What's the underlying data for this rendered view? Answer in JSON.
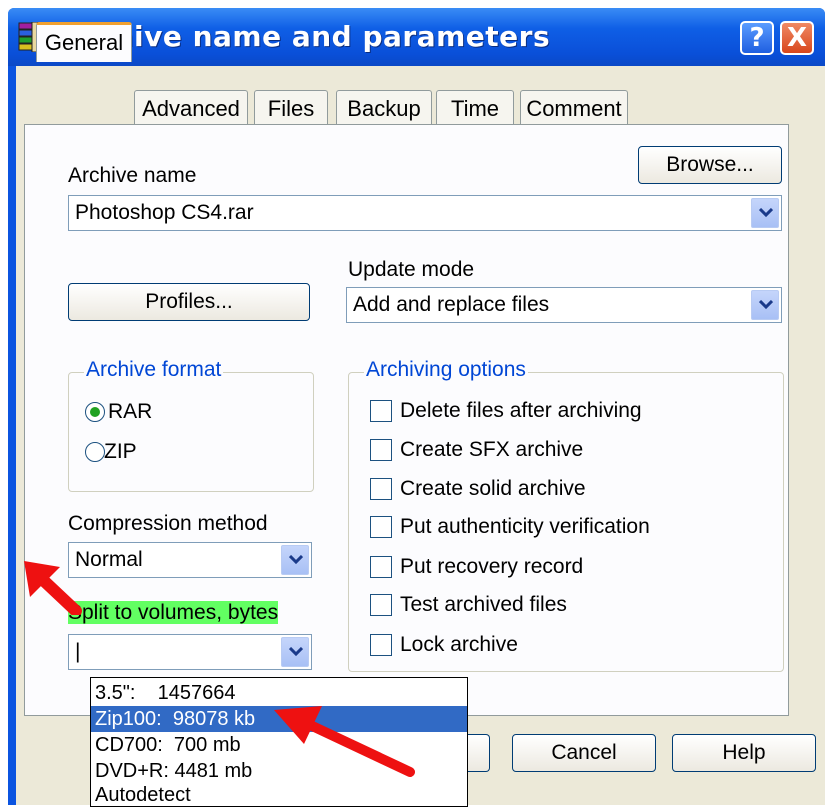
{
  "window": {
    "title": "Archive name and parameters",
    "help_label": "?",
    "close_label": "X"
  },
  "tabs": [
    {
      "label": "General",
      "active": true
    },
    {
      "label": "Advanced",
      "active": false
    },
    {
      "label": "Files",
      "active": false
    },
    {
      "label": "Backup",
      "active": false
    },
    {
      "label": "Time",
      "active": false
    },
    {
      "label": "Comment",
      "active": false
    }
  ],
  "general": {
    "archive_name_label": "Archive name",
    "archive_name_value": "Photoshop CS4.rar",
    "browse_label": "Browse...",
    "update_mode_label": "Update mode",
    "update_mode_value": "Add and replace files",
    "profiles_label": "Profiles...",
    "archive_format": {
      "title": "Archive format",
      "options": [
        {
          "label": "RAR",
          "checked": true
        },
        {
          "label": "ZIP",
          "checked": false
        }
      ]
    },
    "archiving_options": {
      "title": "Archiving options",
      "options": [
        {
          "label": "Delete files after archiving",
          "checked": false
        },
        {
          "label": "Create SFX archive",
          "checked": false
        },
        {
          "label": "Create solid archive",
          "checked": false
        },
        {
          "label": "Put authenticity verification",
          "checked": false
        },
        {
          "label": "Put recovery record",
          "checked": false
        },
        {
          "label": "Test archived files",
          "checked": false
        },
        {
          "label": "Lock archive",
          "checked": false
        }
      ]
    },
    "compression_method_label": "Compression method",
    "compression_method_value": "Normal",
    "split_label": "Split to volumes, bytes",
    "split_value": "|",
    "split_options": [
      {
        "label": "3.5\":    1457664",
        "selected": false
      },
      {
        "label": "Zip100:  98078 kb",
        "selected": true
      },
      {
        "label": "CD700:  700 mb",
        "selected": false
      },
      {
        "label": "DVD+R: 4481 mb",
        "selected": false
      },
      {
        "label": "Autodetect",
        "selected": false
      }
    ]
  },
  "buttons": {
    "cancel_label": "Cancel",
    "help_label": "Help"
  },
  "colors": {
    "titlebar": "#0a4fd8",
    "dialog_bg": "#ece9d8",
    "group_title": "#0046d5",
    "selection": "#316ac5",
    "highlight": "#62ff62",
    "annotation_arrow": "#ee1111"
  },
  "icons": {
    "app": "winrar-books-icon",
    "dropdown": "chevron-down-icon",
    "annotation": "red-arrow-icon"
  }
}
